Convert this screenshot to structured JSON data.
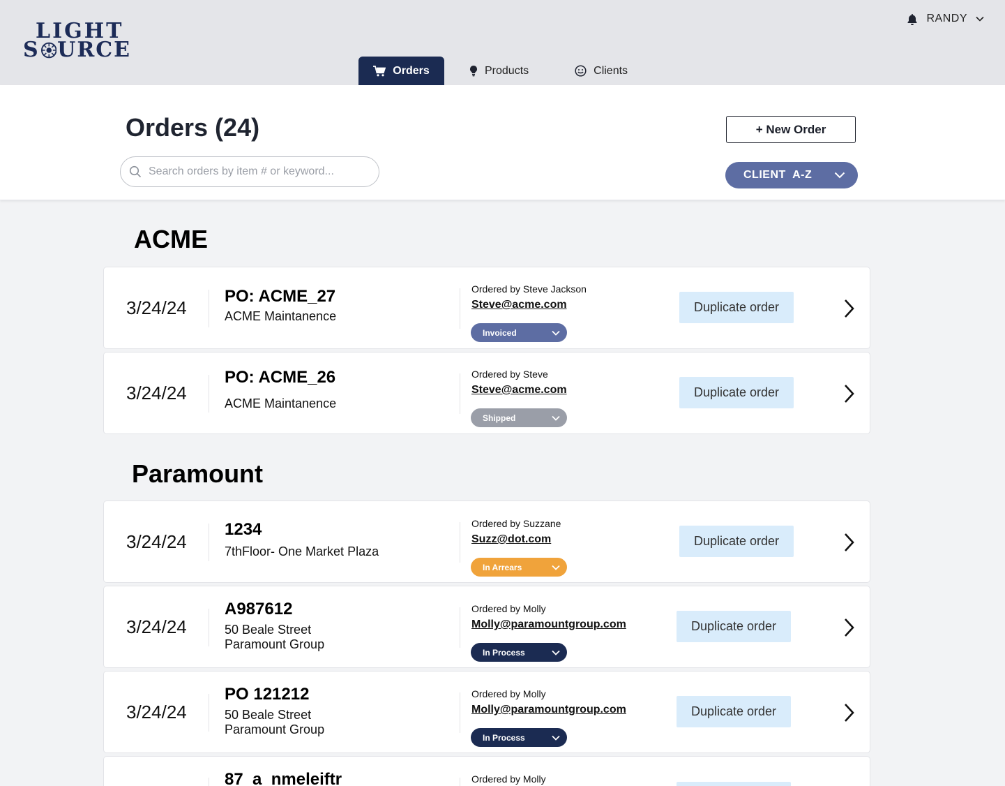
{
  "header": {
    "logo_line1": "LIGHT",
    "logo_line2_a": "S",
    "logo_line2_b": "URCE",
    "user_name": "RANDY"
  },
  "nav": {
    "tabs": [
      {
        "label": "Orders",
        "active": true,
        "icon": "cart-icon"
      },
      {
        "label": "Products",
        "active": false,
        "icon": "lightbulb-icon"
      },
      {
        "label": "Clients",
        "active": false,
        "icon": "smiley-icon"
      }
    ]
  },
  "page": {
    "title": "Orders (24)",
    "search_placeholder": "Search orders by item # or keyword...",
    "new_order_label": "+ New Order",
    "sort_label": "CLIENT  A-Z"
  },
  "colors": {
    "nav_active": "#1b2b52",
    "sort_pill": "#5d6da3",
    "duplicate_bg": "#d9ecfb",
    "status_invoiced": "#5d6da3",
    "status_shipped": "#9a9ea8",
    "status_arrears": "#f0a33b",
    "status_in_process": "#1b2b52"
  },
  "groups": [
    {
      "name": "ACME",
      "orders": [
        {
          "date": "3/24/24",
          "po": "PO: ACME_27",
          "lines": [
            "ACME Maintanence"
          ],
          "ordered_by": "Ordered by Steve Jackson",
          "email": "Steve@acme.com",
          "status": "Invoiced",
          "status_color": "#5d6da3",
          "duplicate_label": "Duplicate order"
        },
        {
          "date": "3/24/24",
          "po": "PO: ACME_26",
          "lines": [
            "ACME Maintanence"
          ],
          "ordered_by": "Ordered by Steve",
          "email": "Steve@acme.com",
          "status": "Shipped",
          "status_color": "#9a9ea8",
          "duplicate_label": "Duplicate order"
        }
      ]
    },
    {
      "name": "Paramount",
      "orders": [
        {
          "date": "3/24/24",
          "po": "1234",
          "lines": [
            "7thFloor- One Market Plaza"
          ],
          "ordered_by": "Ordered by Suzzane",
          "email": "Suzz@dot.com",
          "status": "In Arrears",
          "status_color": "#f0a33b",
          "duplicate_label": "Duplicate order"
        },
        {
          "date": "3/24/24",
          "po": "A987612",
          "lines": [
            "50 Beale Street",
            "Paramount Group"
          ],
          "ordered_by": "Ordered by Molly",
          "email": "Molly@paramountgroup.com",
          "status": "In Process",
          "status_color": "#1b2b52",
          "duplicate_label": "Duplicate order"
        },
        {
          "date": "3/24/24",
          "po": "PO 121212",
          "lines": [
            "50 Beale Street",
            "Paramount Group"
          ],
          "ordered_by": "Ordered by Molly",
          "email": "Molly@paramountgroup.com",
          "status": "In Process",
          "status_color": "#1b2b52",
          "duplicate_label": "Duplicate order"
        },
        {
          "date": "",
          "po": "87_a_nmeleiftr",
          "lines": [],
          "ordered_by": "Ordered by Molly",
          "email": "",
          "status": "",
          "status_color": "#1b2b52",
          "duplicate_label": ""
        }
      ]
    }
  ]
}
